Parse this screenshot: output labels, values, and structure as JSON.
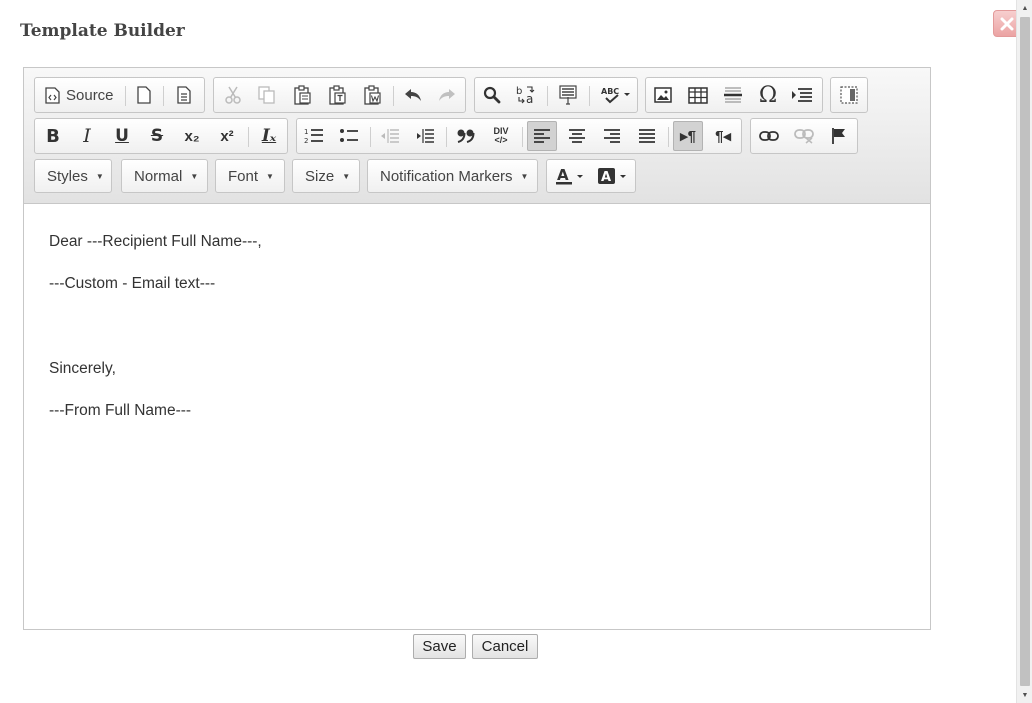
{
  "dialog": {
    "title": "Template Builder"
  },
  "toolbar": {
    "source_label": "Source",
    "glyphs": {
      "subscript": "x₂",
      "superscript": "x²",
      "show_blocks": "DIV",
      "special_char": "Ω",
      "bidi_ltr": "▸¶",
      "bidi_rtl": "¶◂",
      "remove_format": "Iₓ"
    },
    "combos": {
      "styles": "Styles",
      "format": "Normal",
      "font": "Font",
      "size": "Size",
      "markers": "Notification Markers"
    }
  },
  "content": {
    "lines": [
      "Dear ---Recipient Full Name---,",
      "---Custom - Email text---",
      "",
      "Sincerely,",
      "---From Full Name---"
    ]
  },
  "footer": {
    "save_label": "Save",
    "cancel_label": "Cancel"
  },
  "colors": {
    "toolbar_bg": "#e8e8e8",
    "close_button": "#eba3a3",
    "active_button": "#d2d2d2",
    "text": "#333333"
  }
}
